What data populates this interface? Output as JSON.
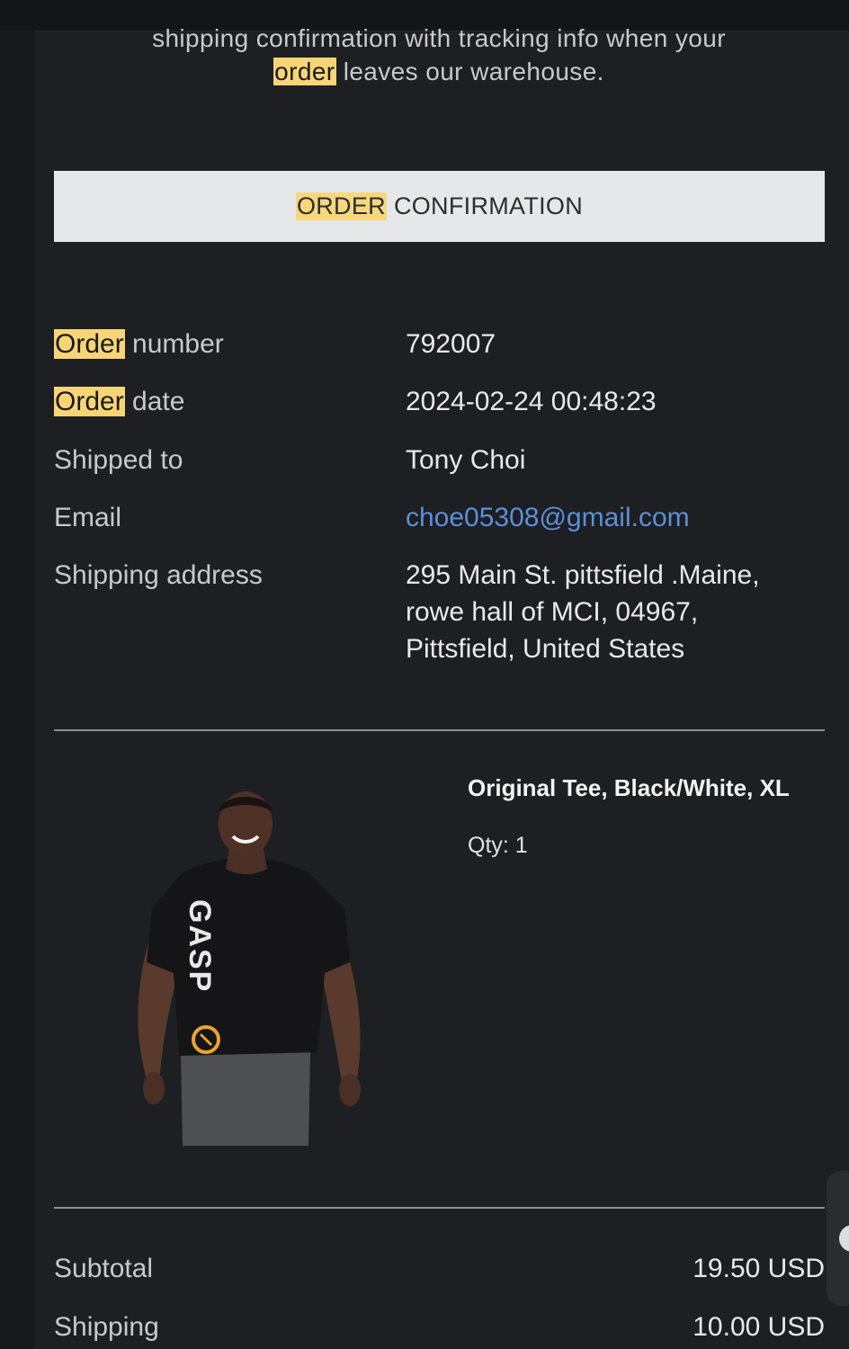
{
  "intro": {
    "line1": "shipping confirmation with tracking info when your",
    "highlight": "order",
    "line2_rest": "leaves our warehouse."
  },
  "banner": {
    "highlight": "ORDER",
    "rest": "CONFIRMATION"
  },
  "order_info": {
    "order_number": {
      "label_highlight": "Order",
      "label_rest": "number",
      "value": "792007"
    },
    "order_date": {
      "label_highlight": "Order",
      "label_rest": "date",
      "value": "2024-02-24 00:48:23"
    },
    "shipped_to": {
      "label": "Shipped to",
      "value": "Tony Choi"
    },
    "email": {
      "label": "Email",
      "value": "choe05308@gmail.com"
    },
    "shipping_address": {
      "label": "Shipping address",
      "line1": "295 Main St. pittsfield .Maine,",
      "line2": "rowe hall of MCI, 04967,",
      "line3": "Pittsfield, United States"
    }
  },
  "product": {
    "name": "Original Tee, Black/White, XL",
    "qty": "Qty: 1",
    "shirt_text": "GASP"
  },
  "summary": {
    "subtotal_label": "Subtotal",
    "subtotal_value": "19.50 USD",
    "shipping_label": "Shipping",
    "shipping_value": "10.00 USD"
  },
  "colors": {
    "background": "#1d1f23",
    "highlight": "#f7d576",
    "link": "#5b8fd8",
    "banner_bg": "#e6e7e9"
  }
}
